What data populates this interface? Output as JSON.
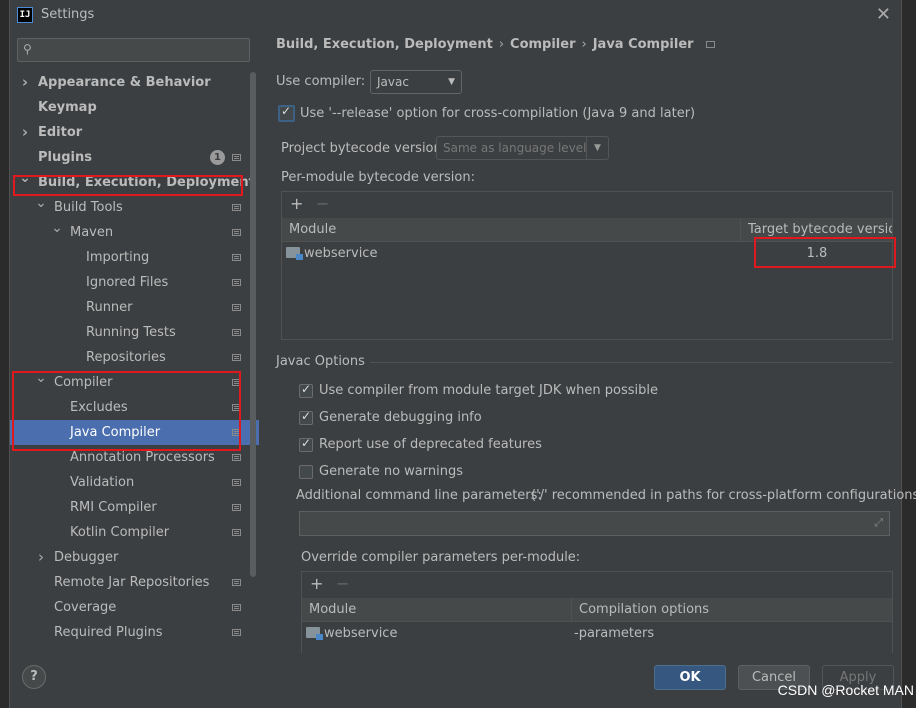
{
  "window": {
    "title": "Settings",
    "app_icon": "IJ"
  },
  "search": {
    "placeholder": ""
  },
  "sidebar": {
    "items": [
      {
        "label": "Appearance & Behavior",
        "level": 0,
        "arrow": "right",
        "bold": true
      },
      {
        "label": "Keymap",
        "level": 0,
        "arrow": "",
        "bold": true
      },
      {
        "label": "Editor",
        "level": 0,
        "arrow": "right",
        "bold": true
      },
      {
        "label": "Plugins",
        "level": 0,
        "arrow": "",
        "bold": true,
        "badge": "1",
        "page_icon": true
      },
      {
        "label": "Build, Execution, Deployment",
        "level": 0,
        "arrow": "down",
        "bold": true
      },
      {
        "label": "Build Tools",
        "level": 1,
        "arrow": "down",
        "page_icon": true
      },
      {
        "label": "Maven",
        "level": 2,
        "arrow": "down",
        "page_icon": true
      },
      {
        "label": "Importing",
        "level": 3,
        "arrow": "",
        "page_icon": true
      },
      {
        "label": "Ignored Files",
        "level": 3,
        "arrow": "",
        "page_icon": true
      },
      {
        "label": "Runner",
        "level": 3,
        "arrow": "",
        "page_icon": true
      },
      {
        "label": "Running Tests",
        "level": 3,
        "arrow": "",
        "page_icon": true
      },
      {
        "label": "Repositories",
        "level": 3,
        "arrow": "",
        "page_icon": true
      },
      {
        "label": "Compiler",
        "level": 1,
        "arrow": "down",
        "page_icon": true
      },
      {
        "label": "Excludes",
        "level": 2,
        "arrow": "",
        "page_icon": true
      },
      {
        "label": "Java Compiler",
        "level": 2,
        "arrow": "",
        "page_icon": true,
        "selected": true
      },
      {
        "label": "Annotation Processors",
        "level": 2,
        "arrow": "",
        "page_icon": true
      },
      {
        "label": "Validation",
        "level": 2,
        "arrow": "",
        "page_icon": true
      },
      {
        "label": "RMI Compiler",
        "level": 2,
        "arrow": "",
        "page_icon": true
      },
      {
        "label": "Kotlin Compiler",
        "level": 2,
        "arrow": "",
        "page_icon": true
      },
      {
        "label": "Debugger",
        "level": 1,
        "arrow": "right",
        "page_icon": false
      },
      {
        "label": "Remote Jar Repositories",
        "level": 1,
        "arrow": "",
        "page_icon": true
      },
      {
        "label": "Coverage",
        "level": 1,
        "arrow": "",
        "page_icon": true
      },
      {
        "label": "Required Plugins",
        "level": 1,
        "arrow": "",
        "page_icon": true
      }
    ]
  },
  "breadcrumb": [
    "Build, Execution, Deployment",
    "Compiler",
    "Java Compiler"
  ],
  "compiler": {
    "use_compiler_label": "Use compiler:",
    "use_compiler_value": "Javac",
    "release_option_label": "Use '--release' option for cross-compilation (Java 9 and later)",
    "release_option_checked": true,
    "project_bytecode_label": "Project bytecode version:",
    "project_bytecode_value": "Same as language level",
    "per_module_label": "Per-module bytecode version:",
    "module_table": {
      "columns": [
        "Module",
        "Target bytecode version"
      ],
      "rows": [
        {
          "module": "webservice",
          "target": "1.8"
        }
      ]
    }
  },
  "javac": {
    "group_title": "Javac Options",
    "options": [
      {
        "label": "Use compiler from module target JDK when possible",
        "checked": true
      },
      {
        "label": "Generate debugging info",
        "checked": true
      },
      {
        "label": "Report use of deprecated features",
        "checked": true
      },
      {
        "label": "Generate no warnings",
        "checked": false
      }
    ],
    "additional_params_label": "Additional command line parameters:",
    "additional_params_hint": "('/' recommended in paths for cross-platform configurations)",
    "additional_params_value": "",
    "override_label": "Override compiler parameters per-module:",
    "override_table": {
      "columns": [
        "Module",
        "Compilation options"
      ],
      "rows": [
        {
          "module": "webservice",
          "options": "-parameters"
        }
      ]
    }
  },
  "buttons": {
    "help": "?",
    "ok": "OK",
    "cancel": "Cancel",
    "apply": "Apply"
  },
  "watermark": "CSDN @Rocket MAN",
  "colors": {
    "accent": "#4b6eaf",
    "highlight": "#e0191f",
    "primary_button": "#365880"
  }
}
